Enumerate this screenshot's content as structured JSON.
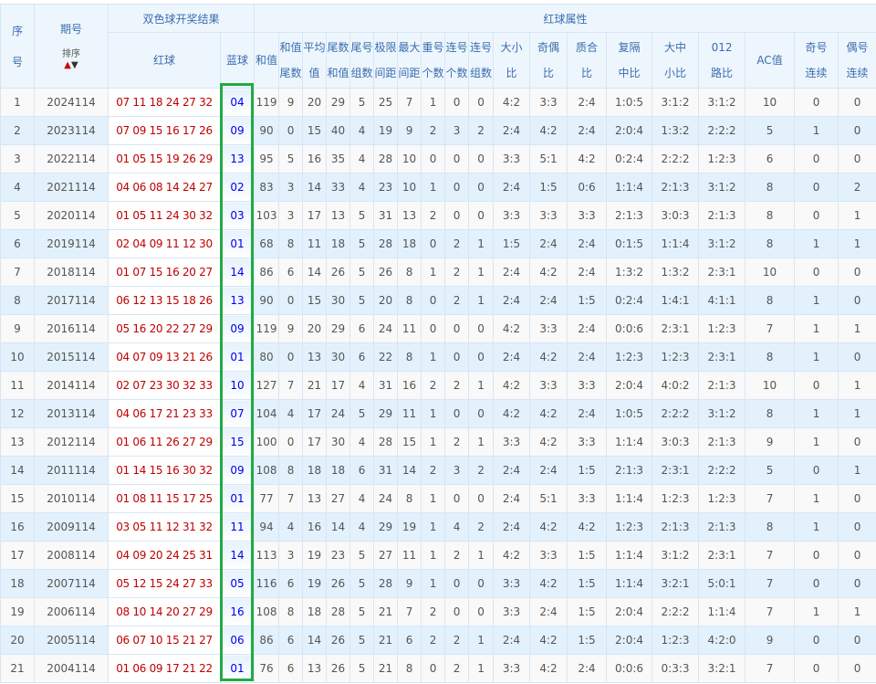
{
  "header": {
    "no": [
      "序",
      "号"
    ],
    "issue": "期号",
    "sort_label": "排序",
    "result_group": "双色球开奖结果",
    "attr_group": "红球属性",
    "red": "红球",
    "blue": "蓝球",
    "attrs": [
      [
        "和值",
        ""
      ],
      [
        "和值",
        "尾数"
      ],
      [
        "平均",
        "值"
      ],
      [
        "尾数",
        "和值"
      ],
      [
        "尾号",
        "组数"
      ],
      [
        "极限",
        "间距"
      ],
      [
        "最大",
        "间距"
      ],
      [
        "重号",
        "个数"
      ],
      [
        "连号",
        "个数"
      ],
      [
        "连号",
        "组数"
      ],
      [
        "大小",
        "比"
      ],
      [
        "奇偶",
        "比"
      ],
      [
        "质合",
        "比"
      ],
      [
        "复隔",
        "中比"
      ],
      [
        "大中",
        "小比"
      ],
      [
        "012",
        "路比"
      ],
      [
        "AC值",
        ""
      ],
      [
        "奇号",
        "连续"
      ],
      [
        "偶号",
        "连续"
      ]
    ]
  },
  "colors": {
    "red_ball": "#c00000",
    "blue_ball": "#0000ee",
    "highlight": "#22aa44"
  },
  "rows": [
    {
      "no": "1",
      "issue": "2024114",
      "red": "07 11 18 24 27 32",
      "blue": "04",
      "attrs": [
        "119",
        "9",
        "20",
        "29",
        "5",
        "25",
        "7",
        "1",
        "0",
        "0",
        "4:2",
        "3:3",
        "2:4",
        "1:0:5",
        "3:1:2",
        "3:1:2",
        "10",
        "0",
        "0"
      ]
    },
    {
      "no": "2",
      "issue": "2023114",
      "red": "07 09 15 16 17 26",
      "blue": "09",
      "attrs": [
        "90",
        "0",
        "15",
        "40",
        "4",
        "19",
        "9",
        "2",
        "3",
        "2",
        "2:4",
        "4:2",
        "2:4",
        "2:0:4",
        "1:3:2",
        "2:2:2",
        "5",
        "1",
        "0"
      ]
    },
    {
      "no": "3",
      "issue": "2022114",
      "red": "01 05 15 19 26 29",
      "blue": "13",
      "attrs": [
        "95",
        "5",
        "16",
        "35",
        "4",
        "28",
        "10",
        "0",
        "0",
        "0",
        "3:3",
        "5:1",
        "4:2",
        "0:2:4",
        "2:2:2",
        "1:2:3",
        "6",
        "0",
        "0"
      ]
    },
    {
      "no": "4",
      "issue": "2021114",
      "red": "04 06 08 14 24 27",
      "blue": "02",
      "attrs": [
        "83",
        "3",
        "14",
        "33",
        "4",
        "23",
        "10",
        "1",
        "0",
        "0",
        "2:4",
        "1:5",
        "0:6",
        "1:1:4",
        "2:1:3",
        "3:1:2",
        "8",
        "0",
        "2"
      ]
    },
    {
      "no": "5",
      "issue": "2020114",
      "red": "01 05 11 24 30 32",
      "blue": "03",
      "attrs": [
        "103",
        "3",
        "17",
        "13",
        "5",
        "31",
        "13",
        "2",
        "0",
        "0",
        "3:3",
        "3:3",
        "3:3",
        "2:1:3",
        "3:0:3",
        "2:1:3",
        "8",
        "0",
        "1"
      ]
    },
    {
      "no": "6",
      "issue": "2019114",
      "red": "02 04 09 11 12 30",
      "blue": "01",
      "attrs": [
        "68",
        "8",
        "11",
        "18",
        "5",
        "28",
        "18",
        "0",
        "2",
        "1",
        "1:5",
        "2:4",
        "2:4",
        "0:1:5",
        "1:1:4",
        "3:1:2",
        "8",
        "1",
        "1"
      ]
    },
    {
      "no": "7",
      "issue": "2018114",
      "red": "01 07 15 16 20 27",
      "blue": "14",
      "attrs": [
        "86",
        "6",
        "14",
        "26",
        "5",
        "26",
        "8",
        "1",
        "2",
        "1",
        "2:4",
        "4:2",
        "2:4",
        "1:3:2",
        "1:3:2",
        "2:3:1",
        "10",
        "0",
        "0"
      ]
    },
    {
      "no": "8",
      "issue": "2017114",
      "red": "06 12 13 15 18 26",
      "blue": "13",
      "attrs": [
        "90",
        "0",
        "15",
        "30",
        "5",
        "20",
        "8",
        "0",
        "2",
        "1",
        "2:4",
        "2:4",
        "1:5",
        "0:2:4",
        "1:4:1",
        "4:1:1",
        "8",
        "1",
        "0"
      ]
    },
    {
      "no": "9",
      "issue": "2016114",
      "red": "05 16 20 22 27 29",
      "blue": "09",
      "attrs": [
        "119",
        "9",
        "20",
        "29",
        "6",
        "24",
        "11",
        "0",
        "0",
        "0",
        "4:2",
        "3:3",
        "2:4",
        "0:0:6",
        "2:3:1",
        "1:2:3",
        "7",
        "1",
        "1"
      ]
    },
    {
      "no": "10",
      "issue": "2015114",
      "red": "04 07 09 13 21 26",
      "blue": "01",
      "attrs": [
        "80",
        "0",
        "13",
        "30",
        "6",
        "22",
        "8",
        "1",
        "0",
        "0",
        "2:4",
        "4:2",
        "2:4",
        "1:2:3",
        "1:2:3",
        "2:3:1",
        "8",
        "1",
        "0"
      ]
    },
    {
      "no": "11",
      "issue": "2014114",
      "red": "02 07 23 30 32 33",
      "blue": "10",
      "attrs": [
        "127",
        "7",
        "21",
        "17",
        "4",
        "31",
        "16",
        "2",
        "2",
        "1",
        "4:2",
        "3:3",
        "3:3",
        "2:0:4",
        "4:0:2",
        "2:1:3",
        "10",
        "0",
        "1"
      ]
    },
    {
      "no": "12",
      "issue": "2013114",
      "red": "04 06 17 21 23 33",
      "blue": "07",
      "attrs": [
        "104",
        "4",
        "17",
        "24",
        "5",
        "29",
        "11",
        "1",
        "0",
        "0",
        "4:2",
        "4:2",
        "2:4",
        "1:0:5",
        "2:2:2",
        "3:1:2",
        "8",
        "1",
        "1"
      ]
    },
    {
      "no": "13",
      "issue": "2012114",
      "red": "01 06 11 26 27 29",
      "blue": "15",
      "attrs": [
        "100",
        "0",
        "17",
        "30",
        "4",
        "28",
        "15",
        "1",
        "2",
        "1",
        "3:3",
        "4:2",
        "3:3",
        "1:1:4",
        "3:0:3",
        "2:1:3",
        "9",
        "1",
        "0"
      ]
    },
    {
      "no": "14",
      "issue": "2011114",
      "red": "01 14 15 16 30 32",
      "blue": "09",
      "attrs": [
        "108",
        "8",
        "18",
        "18",
        "6",
        "31",
        "14",
        "2",
        "3",
        "2",
        "2:4",
        "2:4",
        "1:5",
        "2:1:3",
        "2:3:1",
        "2:2:2",
        "5",
        "0",
        "1"
      ]
    },
    {
      "no": "15",
      "issue": "2010114",
      "red": "01 08 11 15 17 25",
      "blue": "01",
      "attrs": [
        "77",
        "7",
        "13",
        "27",
        "4",
        "24",
        "8",
        "1",
        "0",
        "0",
        "2:4",
        "5:1",
        "3:3",
        "1:1:4",
        "1:2:3",
        "1:2:3",
        "7",
        "1",
        "0"
      ]
    },
    {
      "no": "16",
      "issue": "2009114",
      "red": "03 05 11 12 31 32",
      "blue": "11",
      "attrs": [
        "94",
        "4",
        "16",
        "14",
        "4",
        "29",
        "19",
        "1",
        "4",
        "2",
        "2:4",
        "4:2",
        "4:2",
        "1:2:3",
        "2:1:3",
        "2:1:3",
        "8",
        "1",
        "0"
      ]
    },
    {
      "no": "17",
      "issue": "2008114",
      "red": "04 09 20 24 25 31",
      "blue": "14",
      "attrs": [
        "113",
        "3",
        "19",
        "23",
        "5",
        "27",
        "11",
        "1",
        "2",
        "1",
        "4:2",
        "3:3",
        "1:5",
        "1:1:4",
        "3:1:2",
        "2:3:1",
        "7",
        "0",
        "0"
      ]
    },
    {
      "no": "18",
      "issue": "2007114",
      "red": "05 12 15 24 27 33",
      "blue": "05",
      "attrs": [
        "116",
        "6",
        "19",
        "26",
        "5",
        "28",
        "9",
        "1",
        "0",
        "0",
        "3:3",
        "4:2",
        "1:5",
        "1:1:4",
        "3:2:1",
        "5:0:1",
        "7",
        "0",
        "0"
      ]
    },
    {
      "no": "19",
      "issue": "2006114",
      "red": "08 10 14 20 27 29",
      "blue": "16",
      "attrs": [
        "108",
        "8",
        "18",
        "28",
        "5",
        "21",
        "7",
        "2",
        "0",
        "0",
        "3:3",
        "2:4",
        "1:5",
        "2:0:4",
        "2:2:2",
        "1:1:4",
        "7",
        "1",
        "1"
      ]
    },
    {
      "no": "20",
      "issue": "2005114",
      "red": "06 07 10 15 21 27",
      "blue": "06",
      "attrs": [
        "86",
        "6",
        "14",
        "26",
        "5",
        "21",
        "6",
        "2",
        "2",
        "1",
        "2:4",
        "4:2",
        "1:5",
        "2:0:4",
        "1:2:3",
        "4:2:0",
        "9",
        "0",
        "0"
      ]
    },
    {
      "no": "21",
      "issue": "2004114",
      "red": "01 06 09 17 21 22",
      "blue": "01",
      "attrs": [
        "76",
        "6",
        "13",
        "26",
        "5",
        "21",
        "8",
        "0",
        "2",
        "1",
        "3:3",
        "4:2",
        "2:4",
        "0:0:6",
        "0:3:3",
        "3:2:1",
        "7",
        "0",
        "0"
      ]
    }
  ]
}
